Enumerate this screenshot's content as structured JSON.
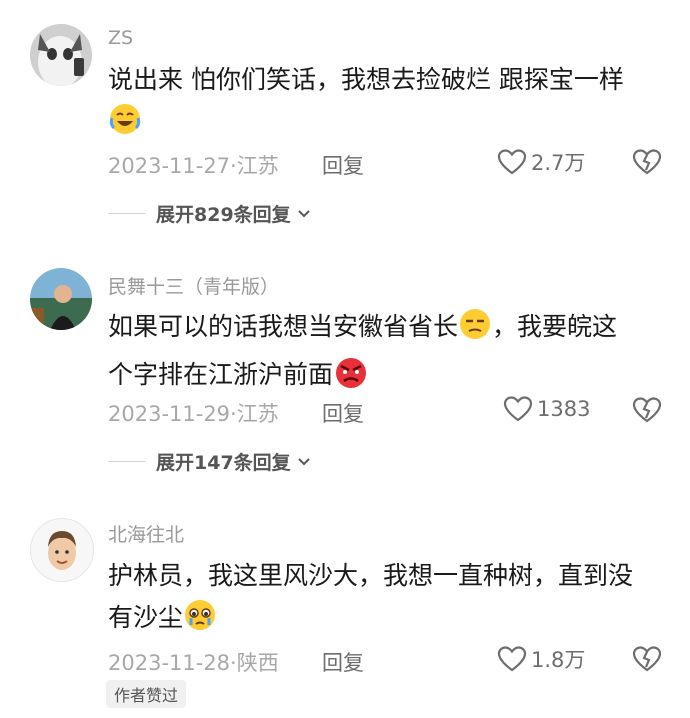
{
  "comments": [
    {
      "username": "ZS",
      "text_parts": [
        "说出来 怕你们笑话，我想去捡破烂 跟探宝一样"
      ],
      "date": "2023-11-27",
      "location": "江苏",
      "reply_label": "回复",
      "likes": "2.7万",
      "expand_label": "展开829条回复",
      "emojis": [
        "laughing-crying-emoji"
      ]
    },
    {
      "username": "民舞十三（青年版）",
      "text_line1": "如果可以的话我想当安徽省省长",
      "text_line1b": "，我要皖这",
      "text_line2": "个字排在江浙沪前面",
      "date": "2023-11-29",
      "location": "江苏",
      "reply_label": "回复",
      "likes": "1383",
      "expand_label": "展开147条回复",
      "emojis": [
        "smirk-emoji",
        "angry-emoji"
      ]
    },
    {
      "username": "北海往北",
      "text_line1": "护林员，我这里风沙大，我想一直种树，直到没",
      "text_line2": "有沙尘",
      "date": "2023-11-28",
      "location": "陕西",
      "reply_label": "回复",
      "likes": "1.8万",
      "badge": "作者赞过",
      "emojis": [
        "teary-emoji"
      ]
    }
  ],
  "separator": "·",
  "icons": {
    "like": "heart-outline-icon",
    "dislike": "broken-heart-icon",
    "expand": "chevron-down-icon"
  }
}
